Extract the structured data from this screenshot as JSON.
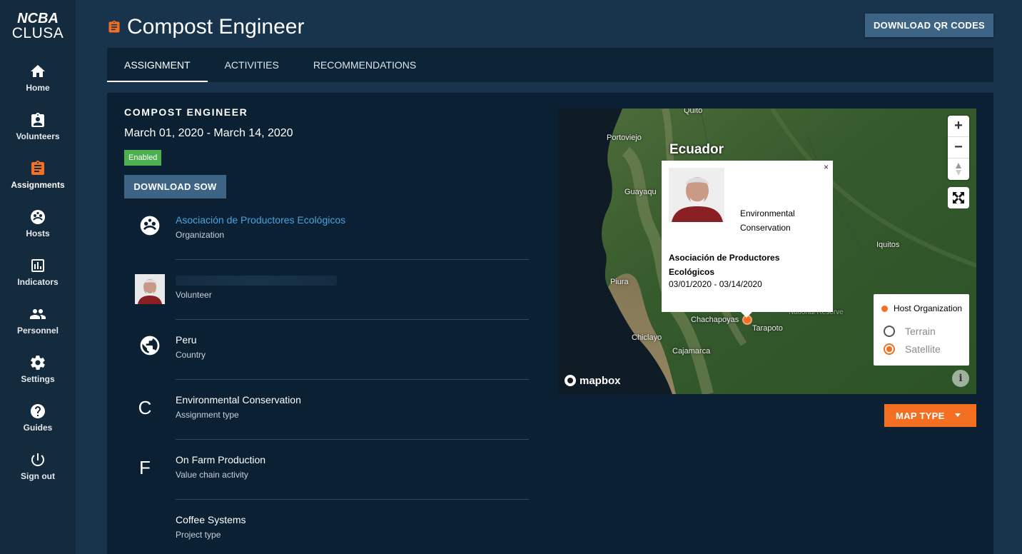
{
  "brand": {
    "line1": "NCBA",
    "line2": "CLUSA"
  },
  "sidebar": {
    "items": [
      {
        "label": "Home",
        "icon": "home-icon"
      },
      {
        "label": "Volunteers",
        "icon": "badge-icon"
      },
      {
        "label": "Assignments",
        "icon": "clipboard-icon"
      },
      {
        "label": "Hosts",
        "icon": "hosts-icon"
      },
      {
        "label": "Indicators",
        "icon": "chart-icon"
      },
      {
        "label": "Personnel",
        "icon": "people-icon"
      },
      {
        "label": "Settings",
        "icon": "gear-icon"
      },
      {
        "label": "Guides",
        "icon": "help-icon"
      },
      {
        "label": "Sign out",
        "icon": "power-icon"
      }
    ],
    "active": "Assignments"
  },
  "header": {
    "title": "Compost Engineer",
    "download_qr_label": "DOWNLOAD QR CODES"
  },
  "tabs": [
    {
      "label": "ASSIGNMENT",
      "active": true
    },
    {
      "label": "ACTIVITIES",
      "active": false
    },
    {
      "label": "RECOMMENDATIONS",
      "active": false
    }
  ],
  "assignment": {
    "heading": "COMPOST ENGINEER",
    "date_range": "March 01, 2020 - March 14, 2020",
    "status": "Enabled",
    "download_sow_label": "DOWNLOAD SOW",
    "details": [
      {
        "primary": "Asociación de Productores Ecológicos",
        "secondary": "Organization"
      },
      {
        "primary": "",
        "secondary": "Volunteer"
      },
      {
        "primary": "Peru",
        "secondary": "Country"
      },
      {
        "letter": "C",
        "primary": "Environmental Conservation",
        "secondary": "Assignment type"
      },
      {
        "letter": "F",
        "primary": "On Farm Production",
        "secondary": "Value chain activity"
      },
      {
        "primary": "Coffee Systems",
        "secondary": "Project type"
      }
    ]
  },
  "map": {
    "labels": {
      "ecuador": "Ecuador",
      "quito": "Quito",
      "portoviejo": "Portoviejo",
      "guayaquil": "Guayaqu",
      "iquitos": "Iquitos",
      "piura": "Piura",
      "chachapoyas": "Chachapoyas",
      "tarapoto": "Tarapoto",
      "chiclayo": "Chiclayo",
      "cajamarca": "Cajamarca",
      "reserve": "National Reserve"
    },
    "popup": {
      "type": "Environmental Conservation",
      "org": "Asociación de Productores Ecológicos",
      "dates": "03/01/2020 - 03/14/2020",
      "close": "×"
    },
    "legend": {
      "host_org": "Host Organization",
      "terrain": "Terrain",
      "satellite": "Satellite",
      "selected": "Satellite"
    },
    "attribution": "mapbox",
    "zoom_in": "+",
    "zoom_out": "−",
    "info": "i",
    "map_type_label": "MAP TYPE"
  },
  "colors": {
    "accent": "#f36f21",
    "button": "#3d6485",
    "link": "#4aa3df",
    "enabled": "#4caf50"
  }
}
